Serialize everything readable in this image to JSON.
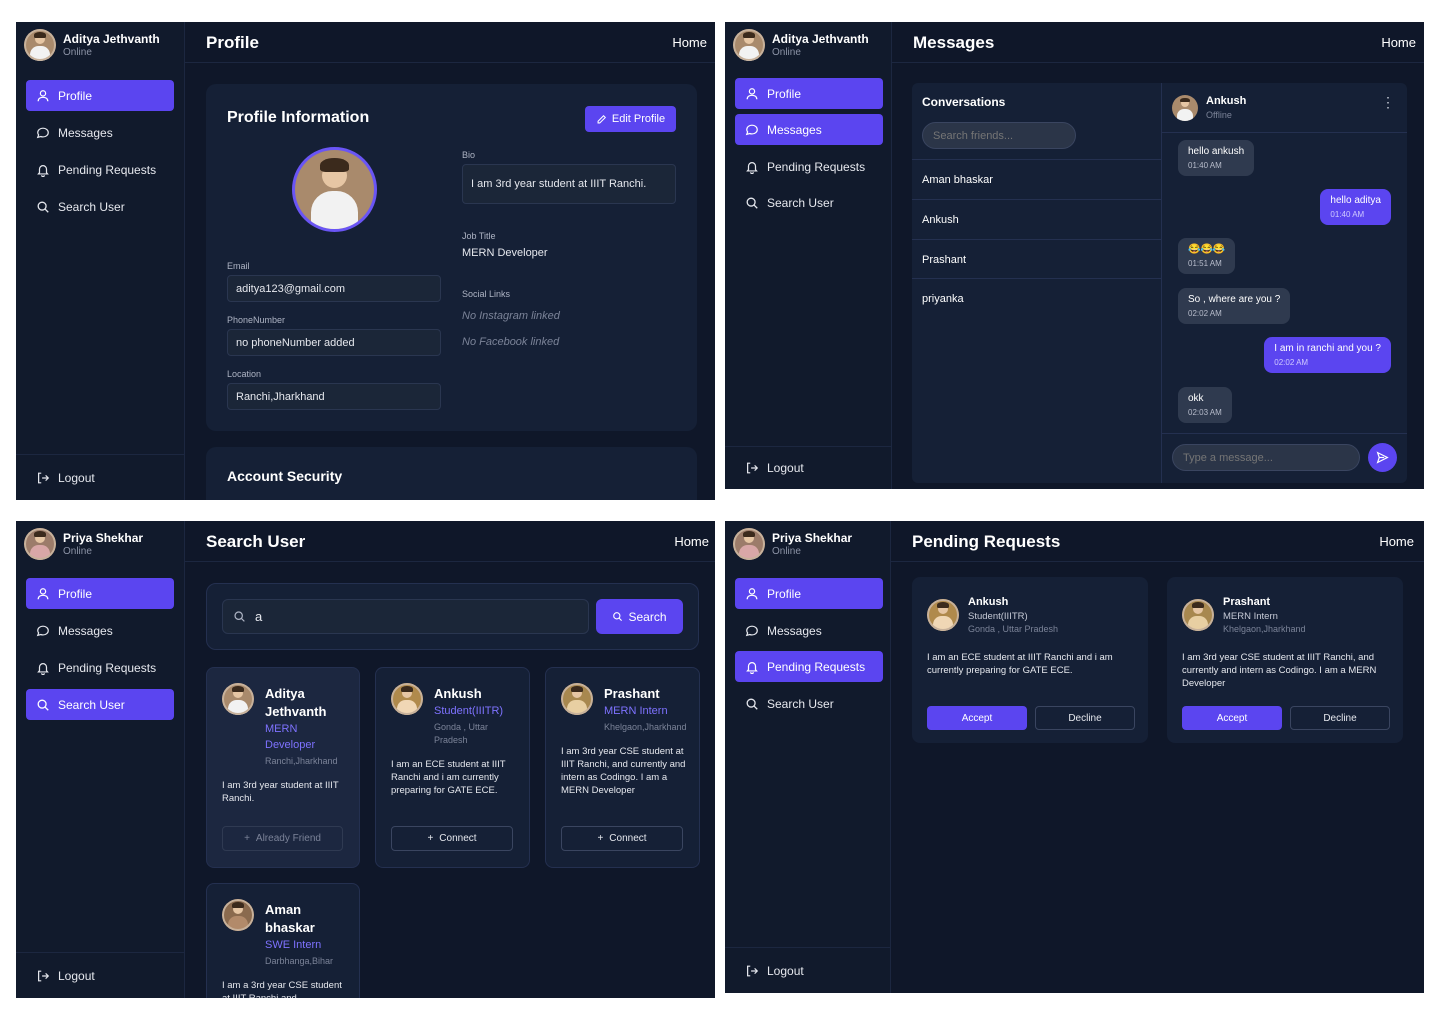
{
  "nav_labels": {
    "profile": "Profile",
    "messages": "Messages",
    "pending": "Pending Requests",
    "search": "Search User",
    "logout": "Logout",
    "home": "Home"
  },
  "s1": {
    "user": {
      "name": "Aditya Jethvanth",
      "status": "Online"
    },
    "title": "Profile",
    "section_title": "Profile Information",
    "edit_button": "Edit Profile",
    "email_label": "Email",
    "email": "aditya123@gmail.com",
    "phone_label": "PhoneNumber",
    "phone": "no phoneNumber added",
    "location_label": "Location",
    "location": "Ranchi,Jharkhand",
    "bio_label": "Bio",
    "bio": "I am 3rd year student at IIIT Ranchi.",
    "job_label": "Job Title",
    "job": "MERN Developer",
    "social_label": "Social Links",
    "instagram": "No Instagram linked",
    "facebook": "No Facebook linked",
    "security_title": "Account Security"
  },
  "s2": {
    "user": {
      "name": "Aditya Jethvanth",
      "status": "Online"
    },
    "title": "Messages",
    "conversations_title": "Conversations",
    "search_placeholder": "Search friends...",
    "conversations": [
      "Aman bhaskar",
      "Ankush",
      "Prashant",
      "priyanka"
    ],
    "chat_name": "Ankush",
    "chat_status": "Offline",
    "messages": [
      {
        "text": "hello ankush",
        "time": "01:40 AM",
        "dir": "in"
      },
      {
        "text": "hello aditya",
        "time": "01:40 AM",
        "dir": "out"
      },
      {
        "text": "😂😂😂",
        "time": "01:51 AM",
        "dir": "in"
      },
      {
        "text": "So , where are you ?",
        "time": "02:02 AM",
        "dir": "in"
      },
      {
        "text": "I am in ranchi and you ?",
        "time": "02:02 AM",
        "dir": "out"
      },
      {
        "text": "okk",
        "time": "02:03 AM",
        "dir": "in"
      }
    ],
    "message_placeholder": "Type a message..."
  },
  "s3": {
    "user": {
      "name": "Priya Shekhar",
      "status": "Online"
    },
    "title": "Search User",
    "query": "a",
    "search_button": "Search",
    "results": [
      {
        "name": "Aditya Jethvanth",
        "role": "MERN Developer",
        "loc": "Ranchi,Jharkhand",
        "bio": "I am 3rd year student at IIIT Ranchi.",
        "action": "Already Friend"
      },
      {
        "name": "Ankush",
        "role": "Student(IIITR)",
        "loc": "Gonda , Uttar Pradesh",
        "bio": "I am an ECE student at IIIT Ranchi and i am currently preparing for GATE ECE.",
        "action": "Connect"
      },
      {
        "name": "Prashant",
        "role": "MERN Intern",
        "loc": "Khelgaon,Jharkhand",
        "bio": "I am 3rd year CSE student at IIIT Ranchi, and currently and intern as Codingo. I am a MERN Developer",
        "action": "Connect"
      },
      {
        "name": "Aman bhaskar",
        "role": "SWE Intern",
        "loc": "Darbhanga,Bihar",
        "bio": "I am a 3rd year CSE student at IIIT Ranchi and",
        "action": ""
      }
    ]
  },
  "s4": {
    "user": {
      "name": "Priya Shekhar",
      "status": "Online"
    },
    "title": "Pending Requests",
    "requests": [
      {
        "name": "Ankush",
        "role": "Student(IIITR)",
        "loc": "Gonda , Uttar Pradesh",
        "bio": "I am an ECE student at IIIT Ranchi and i am currently preparing for GATE ECE.",
        "accept": "Accept",
        "decline": "Decline"
      },
      {
        "name": "Prashant",
        "role": "MERN Intern",
        "loc": "Khelgaon,Jharkhand",
        "bio": "I am 3rd year CSE student at IIIT Ranchi, and currently and intern as Codingo. I am a MERN Developer",
        "accept": "Accept",
        "decline": "Decline"
      }
    ]
  },
  "colors": {
    "accent": "#5b45f0",
    "background": "#0f1729",
    "sidebar": "#111a2c",
    "card": "#152036",
    "role_text": "#7e72ff"
  }
}
